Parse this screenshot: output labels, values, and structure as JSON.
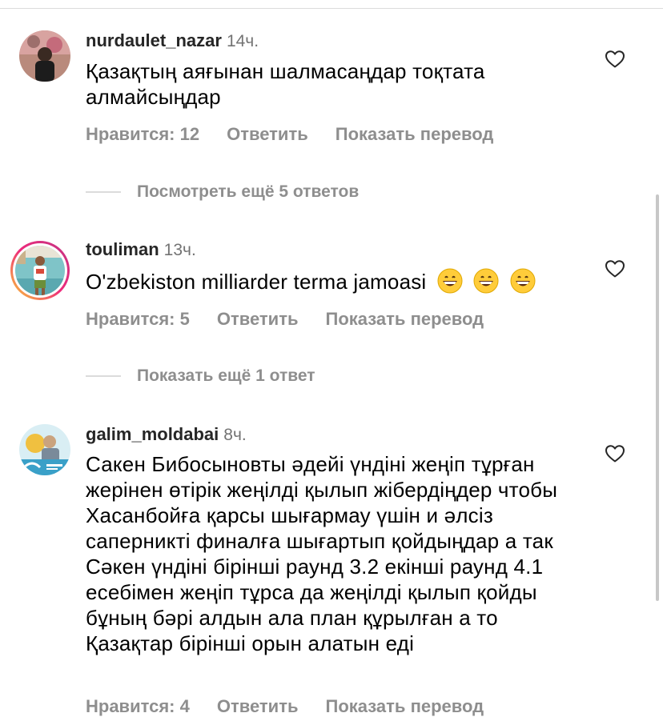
{
  "comments": [
    {
      "username": "nurdaulet_nazar",
      "time": "14ч.",
      "text": "Қазақтың аяғынан шалмасаңдар тоқтата алмайсыңдар",
      "likes_label": "Нравится: 12",
      "reply_label": "Ответить",
      "translate_label": "Показать перевод",
      "more_replies_label": "Посмотреть ещё 5 ответов"
    },
    {
      "username": "touliman",
      "time": "13ч.",
      "text": "O'zbekiston milliarder terma jamoasi",
      "emoji_name": "grinning-face-emoji",
      "likes_label": "Нравится: 5",
      "reply_label": "Ответить",
      "translate_label": "Показать перевод",
      "more_replies_label": "Показать ещё 1 ответ"
    },
    {
      "username": "galim_moldabai",
      "time": "8ч.",
      "text": "Сакен Бибосыновты әдейі үндіні жеңіп тұрған жерінен өтірік жеңілді қылып жібердіңдер чтобы Хасанбойға қарсы шығармау үшін и әлсіз саперникті финалға шығартып қойдыңдар а так Сәкен үндіні бірінші раунд 3.2 екінші раунд 4.1 есебімен жеңіп тұрса да жеңілді қылып қойды бұның бәрі алдын ала план құрылған а то Қазақтар бірінші орын алатын еді",
      "likes_label": "Нравится: 4",
      "reply_label": "Ответить",
      "translate_label": "Показать перевод"
    }
  ],
  "colors": {
    "secondary_text": "#8e8e8e",
    "divider": "#dbdbdb",
    "story_ring_start": "#f9ce34",
    "story_ring_end": "#c13584"
  },
  "icons": {
    "like": "heart-outline-icon"
  }
}
